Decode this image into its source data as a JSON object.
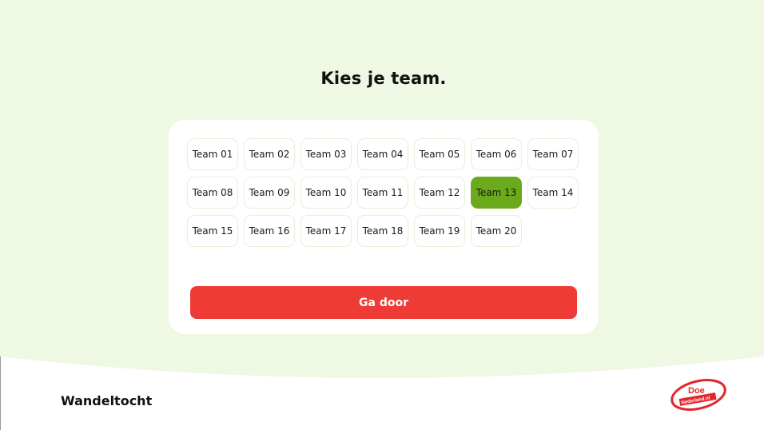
{
  "header": {
    "title": "Kies je team."
  },
  "teams": [
    {
      "label": "Team 01"
    },
    {
      "label": "Team 02"
    },
    {
      "label": "Team 03"
    },
    {
      "label": "Team 04"
    },
    {
      "label": "Team 05"
    },
    {
      "label": "Team 06"
    },
    {
      "label": "Team 07"
    },
    {
      "label": "Team 08"
    },
    {
      "label": "Team 09"
    },
    {
      "label": "Team 10"
    },
    {
      "label": "Team 11"
    },
    {
      "label": "Team 12"
    },
    {
      "label": "Team 13"
    },
    {
      "label": "Team 14"
    },
    {
      "label": "Team 15"
    },
    {
      "label": "Team 16"
    },
    {
      "label": "Team 17"
    },
    {
      "label": "Team 18"
    },
    {
      "label": "Team 19"
    },
    {
      "label": "Team 20"
    }
  ],
  "selected_team": "Team 13",
  "actions": {
    "continue_label": "Ga door"
  },
  "footer": {
    "title": "Wandeltocht",
    "logo_text_top": "Doe",
    "logo_text_bottom": "Nederland.nl"
  },
  "colors": {
    "background_green": "#eef8e3",
    "selected_green": "#6aaa1c",
    "button_red": "#ef3b36",
    "logo_red": "#e3262b"
  }
}
